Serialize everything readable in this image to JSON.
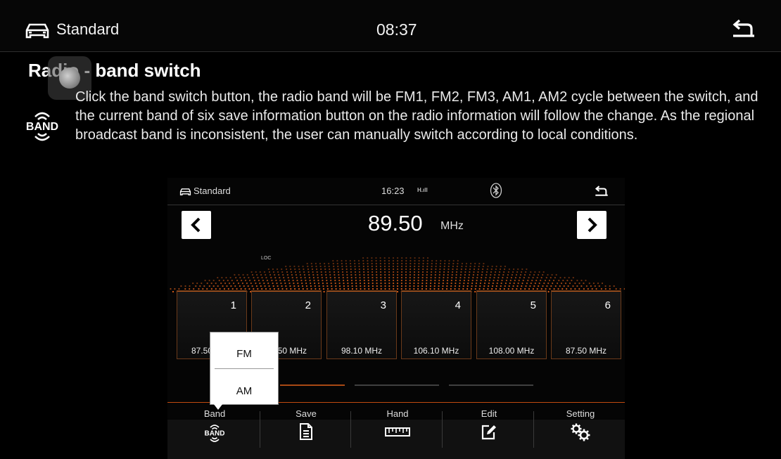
{
  "topbar": {
    "title": "Standard",
    "time": "08:37"
  },
  "page": {
    "heading": "Radio - band switch",
    "description": "Click the band switch button, the radio band will be FM1, FM2, FM3, AM1, AM2 cycle between the switch, and the current band of six save information button on the radio information will follow the change. As the regional broadcast band is inconsistent, the user can manually switch according to local conditions.",
    "band_icon_text": "BAND"
  },
  "radio": {
    "title": "Standard",
    "time": "16:23",
    "signal_text": "H.ıll",
    "frequency": "89.50",
    "unit": "MHz",
    "loc_label": "LOC",
    "presets": [
      {
        "num": "1",
        "freq": "87.50 MHz"
      },
      {
        "num": "2",
        "freq": "87.50 MHz"
      },
      {
        "num": "3",
        "freq": "98.10 MHz"
      },
      {
        "num": "4",
        "freq": "106.10 MHz"
      },
      {
        "num": "5",
        "freq": "108.00 MHz"
      },
      {
        "num": "6",
        "freq": "87.50 MHz"
      }
    ],
    "band_popup": {
      "fm": "FM",
      "am": "AM"
    },
    "toolbar": {
      "band": "Band",
      "band_icon_text": "BAND",
      "save": "Save",
      "hand": "Hand",
      "edit": "Edit",
      "setting": "Setting"
    },
    "colors": {
      "accent": "#e0601a"
    }
  }
}
